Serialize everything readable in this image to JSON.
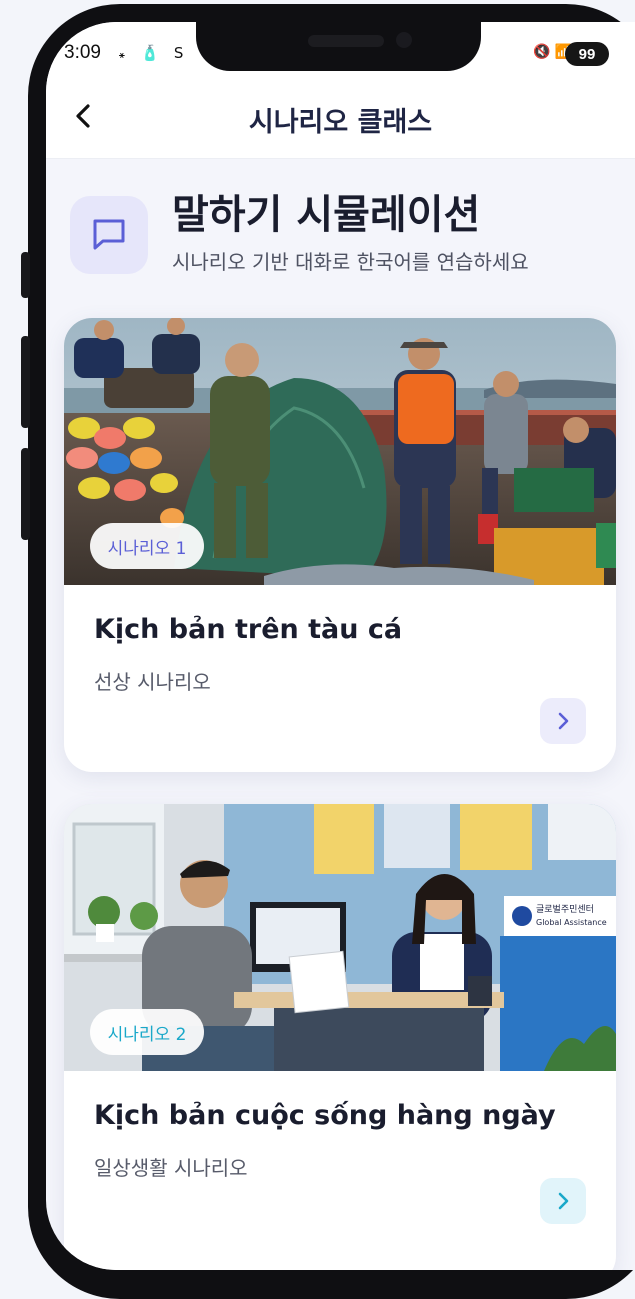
{
  "status_bar": {
    "time": "3:09",
    "left_icons": "꘎ 🧴 S",
    "right_icons": "🔇 📶 .ıl",
    "battery": "99"
  },
  "header": {
    "title": "시나리오 클래스"
  },
  "hero": {
    "title": "말하기 시뮬레이션",
    "subtitle": "시나리오 기반 대화로 한국어를 연습하세요",
    "icon": "chat-bubble-icon"
  },
  "cards": [
    {
      "badge": "시나리오 1",
      "title": "Kịch bản trên tàu cá",
      "subtitle": "선상 시나리오",
      "accent": "#5b5fd6",
      "arrow_bg": "#ececfb",
      "image": "fishing-boat-crew-photo"
    },
    {
      "badge": "시나리오 2",
      "title": "Kịch bản cuộc sống hàng ngày",
      "subtitle": "일상생활 시나리오",
      "accent": "#1aa8c9",
      "arrow_bg": "#e1f4fa",
      "image": "office-consultation-photo",
      "sign_korean": "글로벌주민센터",
      "sign_english": "Global Assistance"
    }
  ],
  "colors": {
    "indigo_accent": "#5b5fd6",
    "cyan_accent": "#1aa8c9",
    "title_dark": "#1f2544"
  }
}
